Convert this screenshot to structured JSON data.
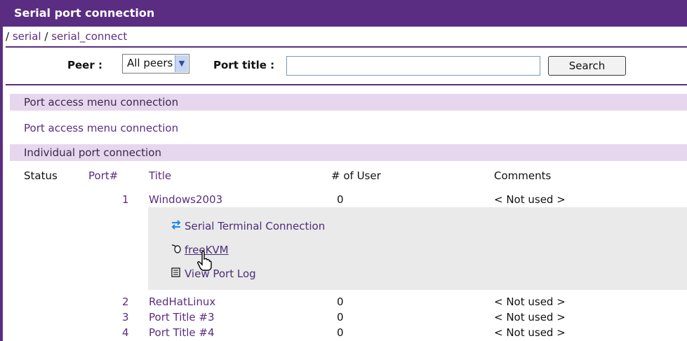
{
  "header": {
    "title": "Serial port connection"
  },
  "breadcrumb": {
    "sep1": "/",
    "part1": "serial",
    "sep2": "/",
    "part2": "serial_connect"
  },
  "filter": {
    "peer_label": "Peer :",
    "peer_value": "All peers",
    "port_title_label": "Port title :",
    "port_title_value": "",
    "search_label": "Search"
  },
  "sections": {
    "access_band": "Port access menu connection",
    "access_link": "Port access menu connection",
    "individual_band": "Individual port connection"
  },
  "table": {
    "headers": [
      "Status",
      "Port#",
      "Title",
      "# of User",
      "Comments"
    ],
    "rows": [
      {
        "port": "1",
        "title": "Windows2003",
        "users": "0",
        "comment": "< Not used >"
      },
      {
        "port": "2",
        "title": "RedHatLinux",
        "users": "0",
        "comment": "< Not used >"
      },
      {
        "port": "3",
        "title": "Port Title #3",
        "users": "0",
        "comment": "< Not used >"
      },
      {
        "port": "4",
        "title": "Port Title #4",
        "users": "0",
        "comment": "< Not used >"
      }
    ]
  },
  "actions": {
    "serial_terminal": "Serial Terminal Connection",
    "freekvm": "freeKVM",
    "view_log": "View Port Log"
  },
  "colors": {
    "accent": "#5a2d82",
    "band": "#e6d7ee",
    "panel": "#eaeaea"
  },
  "icons": {
    "serial_terminal": "swap-arrows-icon",
    "freekvm": "mouse-icon",
    "view_log": "log-document-icon",
    "cursor": "hand-pointer-icon"
  }
}
